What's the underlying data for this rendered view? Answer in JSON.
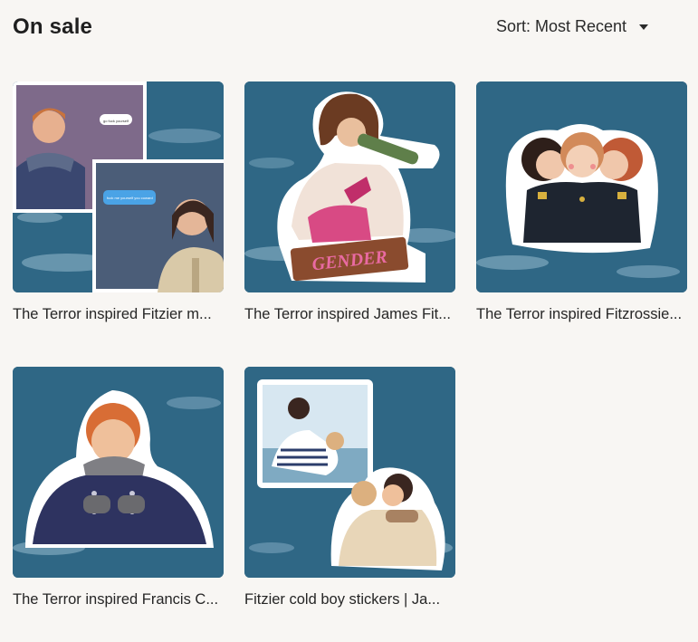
{
  "header": {
    "title": "On sale",
    "sort_label": "Sort: Most Recent"
  },
  "products": [
    {
      "title": "The Terror inspired Fitzier m..."
    },
    {
      "title": "The Terror inspired James Fit..."
    },
    {
      "title": "The Terror inspired Fitzrossie..."
    },
    {
      "title": "The Terror inspired Francis C..."
    },
    {
      "title": "Fitzier cold boy stickers | Ja..."
    }
  ],
  "artwork_text": {
    "speech_bubble_1": "go fuck yourself",
    "speech_bubble_2": "fuck me yourself you coward",
    "sign": "GENDER"
  },
  "colors": {
    "background": "#f8f6f3",
    "sea": "#2e6581",
    "text": "#222222"
  }
}
